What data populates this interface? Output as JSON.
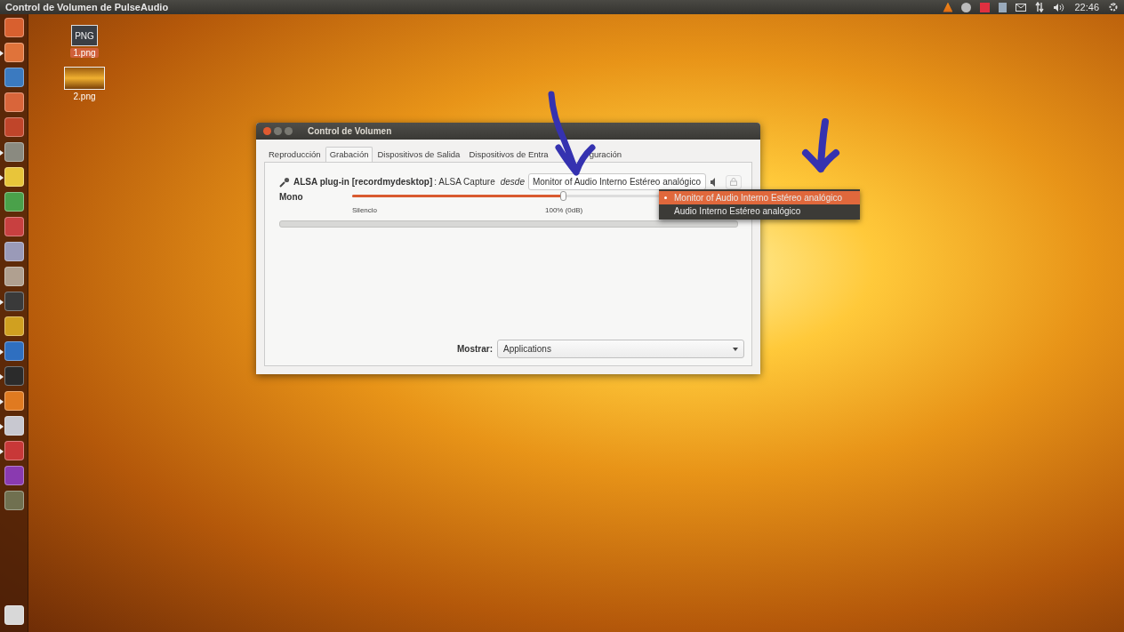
{
  "top_panel": {
    "title": "Control de Volumen de PulseAudio",
    "clock": "22:46"
  },
  "launcher": {
    "items": [
      {
        "running": false
      },
      {
        "running": true
      },
      {
        "running": false
      },
      {
        "running": false
      },
      {
        "running": false
      },
      {
        "running": true
      },
      {
        "running": true
      },
      {
        "running": false
      },
      {
        "running": false
      },
      {
        "running": false
      },
      {
        "running": false
      },
      {
        "running": true
      },
      {
        "running": false
      },
      {
        "running": true
      },
      {
        "running": true
      },
      {
        "running": true
      },
      {
        "running": true
      },
      {
        "running": true
      },
      {
        "running": false
      },
      {
        "running": false
      },
      {
        "running": false
      }
    ]
  },
  "desktop_icons": [
    {
      "kind": "file",
      "badge": "PNG",
      "label": "1.png",
      "selected": true
    },
    {
      "kind": "image",
      "label": "2.png",
      "selected": false
    }
  ],
  "window": {
    "title": "Control de Volumen",
    "tabs": [
      {
        "label": "Reproducción",
        "selected": false
      },
      {
        "label": "Grabación",
        "selected": true
      },
      {
        "label": "Dispositivos de Salida",
        "selected": false
      },
      {
        "label": "Dispositivos de Entra",
        "selected": false
      },
      {
        "label": "guración",
        "selected": false
      }
    ],
    "stream": {
      "name": "ALSA plug-in [recordmydesktop]",
      "detail": ": ALSA Capture",
      "from_label": "desde",
      "device": "Monitor of Audio Interno Estéreo analógico",
      "channel": "Mono",
      "level": 0.55,
      "marks": [
        "Silencio",
        "100% (0dB)"
      ]
    },
    "show_label": "Mostrar:",
    "show_value": "Applications"
  },
  "device_menu": {
    "items": [
      {
        "label": "Monitor of Audio Interno Estéreo analógico",
        "selected": true
      },
      {
        "label": "Audio Interno Estéreo analógico",
        "selected": false
      }
    ]
  }
}
